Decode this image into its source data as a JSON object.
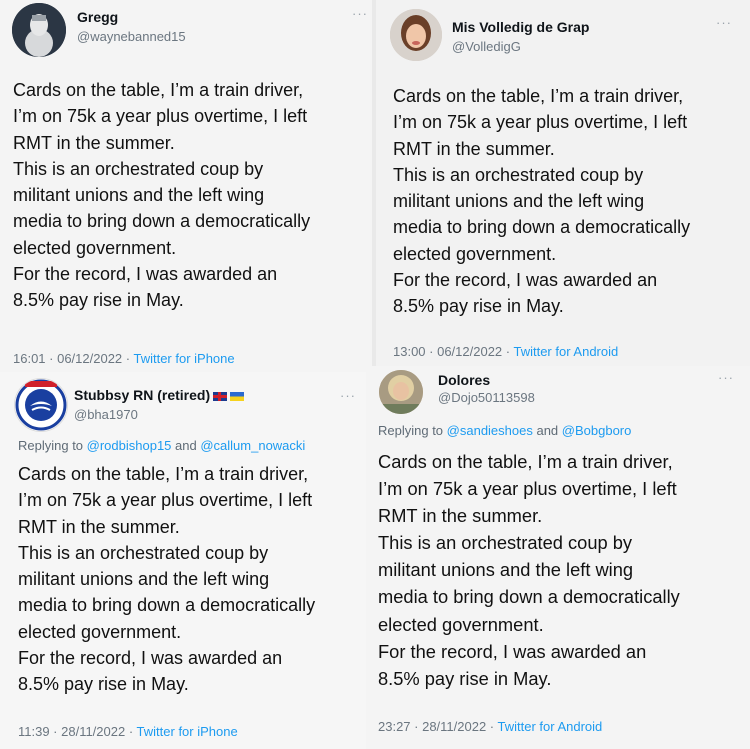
{
  "tweets": [
    {
      "name": "Gregg",
      "handle": "@waynebanned15",
      "more": "···",
      "reply_prefix": "",
      "mentions": [],
      "body": "Cards on the table, I’m a train driver,\nI’m on 75k a year plus overtime, I left\nRMT in the summer.\nThis is an orchestrated coup by\nmilitant unions and the left wing\nmedia to bring down a democratically\nelected government.\nFor the record, I was awarded an\n8.5% pay rise in May.",
      "time": "16:01 · 06/12/2022 · ",
      "source": "Twitter for iPhone"
    },
    {
      "name": "Mis Volledig de Grap",
      "handle": "@VolledigG",
      "more": "···",
      "reply_prefix": "",
      "mentions": [],
      "body": "Cards on the table, I’m a train driver,\nI’m on 75k a year plus overtime, I left\nRMT in the summer.\nThis is an orchestrated coup by\nmilitant unions and the left wing\nmedia to bring down a democratically\nelected government.\nFor the record, I was awarded an\n8.5% pay rise in May.",
      "time": "13:00 · 06/12/2022 · ",
      "source": "Twitter for Android"
    },
    {
      "name": "Stubbsy RN (retired)",
      "handle": "@bha1970",
      "more": "···",
      "reply_prefix": "Replying to ",
      "mentions": [
        "@rodbishop15",
        "@callum_nowacki"
      ],
      "reply_and": " and ",
      "body": "Cards on the table, I’m a train driver,\nI’m on 75k a year plus overtime, I left\nRMT in the summer.\nThis is an orchestrated coup by\nmilitant unions and the left wing\nmedia to bring down a democratically\nelected government.\nFor the record, I was awarded an\n8.5% pay rise in May.",
      "time": "11:39 · 28/11/2022 · ",
      "source": "Twitter for iPhone"
    },
    {
      "name": "Dolores",
      "handle": "@Dojo50113598",
      "more": "···",
      "reply_prefix": "Replying to ",
      "mentions": [
        "@sandieshoes",
        "@Bobgboro"
      ],
      "reply_and": " and ",
      "body": "Cards on the table, I’m a train driver,\nI’m on 75k a year plus overtime, I left\nRMT in the summer.\nThis is an orchestrated coup by\nmilitant unions and the left wing\nmedia to bring down a democratically\nelected government.\nFor the record, I was awarded an\n8.5% pay rise in May.",
      "time": "23:27 · 28/11/2022 · ",
      "source": "Twitter for Android"
    }
  ],
  "icons": {
    "flag_uk": "uk-flag-icon",
    "flag_ua": "ukraine-flag-icon",
    "more": "more-options-icon"
  },
  "colors": {
    "link": "#1d9bf0",
    "muted": "#6b7680"
  }
}
